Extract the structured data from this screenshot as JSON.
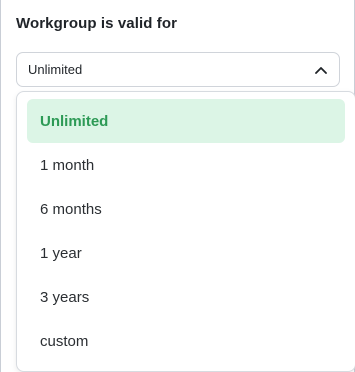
{
  "field": {
    "label": "Workgroup is valid for",
    "selected_value": "Unlimited",
    "toggle_icon": "chevron-up-icon"
  },
  "dropdown": {
    "options": [
      {
        "label": "Unlimited",
        "selected": true
      },
      {
        "label": "1 month",
        "selected": false
      },
      {
        "label": "6 months",
        "selected": false
      },
      {
        "label": "1 year",
        "selected": false
      },
      {
        "label": "3 years",
        "selected": false
      },
      {
        "label": "custom",
        "selected": false
      }
    ]
  },
  "colors": {
    "selected_background": "#dcf5e6",
    "selected_text": "#2d9a56",
    "border": "#d0d4da"
  }
}
